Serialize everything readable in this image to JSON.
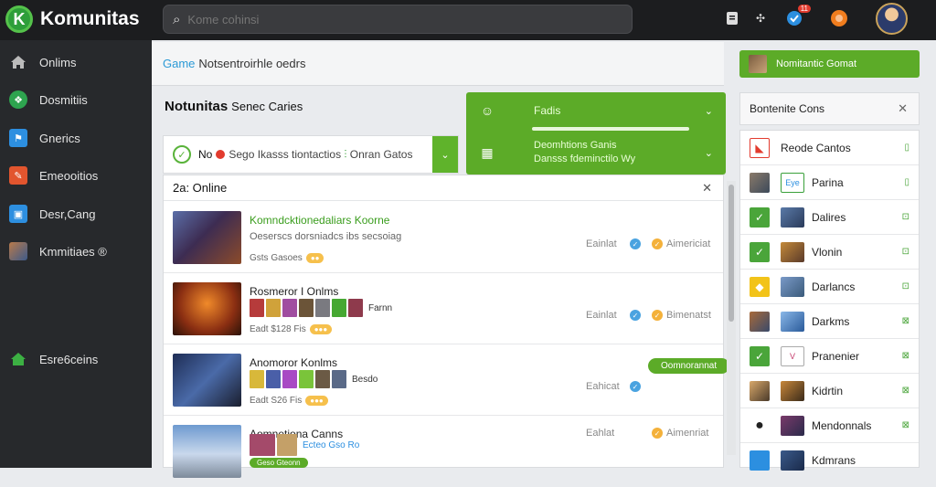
{
  "app": {
    "title": "Komunitas"
  },
  "search": {
    "placeholder": "Kome cohinsi"
  },
  "topbar": {
    "notif_count": "11"
  },
  "sidebar": {
    "items": [
      {
        "label": "Onlims",
        "icon": "home-icon"
      },
      {
        "label": "Dosmitiis",
        "icon": "shield-icon"
      },
      {
        "label": "Gnerics",
        "icon": "flag-icon"
      },
      {
        "label": "Emeooitios",
        "icon": "tag-icon"
      },
      {
        "label": "Desr,Cang",
        "icon": "window-icon"
      },
      {
        "label": "Kmmitiaes ®",
        "icon": "user-icon"
      },
      {
        "label": "Esre6ceins",
        "icon": "house-icon"
      }
    ]
  },
  "header": {
    "breadcrumb_hl": "Game",
    "breadcrumb_rest": "Notsentroirhle oedrs"
  },
  "section": {
    "title": "Notunitas",
    "subtitle": "Senec Caries"
  },
  "filter": {
    "prefix": "No",
    "text": "Sego Ikasss tiontactios",
    "suffix": "Onran Gatos"
  },
  "green_panel": {
    "row1_label": "Fadis",
    "row2_line1": "Deomhtions Ganis",
    "row2_line2": "Dansss fdeminctilo  Wy"
  },
  "list": {
    "header": "2a: Online",
    "rows": [
      {
        "title": "Komndcktionedaliars Koorne",
        "sub": "Oeserscs dorsniadcs ibs secsoiag",
        "meta": "Gsts Gasoes",
        "status": "Eainlat",
        "right": "Aimericiat"
      },
      {
        "title": "Rosmeror I Onlms",
        "avatars_label": "Farnn",
        "meta": "Eadt $128 Fis",
        "status": "Eainlat",
        "right": "Bimenatst"
      },
      {
        "title": "Anomoror Konlms",
        "avatars_label": "Besdo",
        "meta": "Eadt S26 Fis",
        "status": "Eahicat",
        "pill": "Oomnorannat"
      },
      {
        "title": "Aomnetiona Canns",
        "avatars_label": "Ecteo Gso Ro",
        "meta": "Geso Gteonn",
        "status": "Eahlat",
        "right": "Aimenriat"
      }
    ]
  },
  "right": {
    "button": "Nomitantic Gomat",
    "panel_title": "Bontenite Cons",
    "items": [
      {
        "label": "Reode Cantos"
      },
      {
        "label": "Parina"
      },
      {
        "label": "Dalires"
      },
      {
        "label": "Vlonin"
      },
      {
        "label": "Darlancs"
      },
      {
        "label": "Darkms"
      },
      {
        "label": "Pranenier"
      },
      {
        "label": "Kidrtin"
      },
      {
        "label": "Mendonnals"
      },
      {
        "label": "Kdmrans"
      }
    ]
  },
  "colors": {
    "accent": "#5cab28",
    "topbar": "#1c1d1f",
    "sidebar": "#27292c"
  }
}
